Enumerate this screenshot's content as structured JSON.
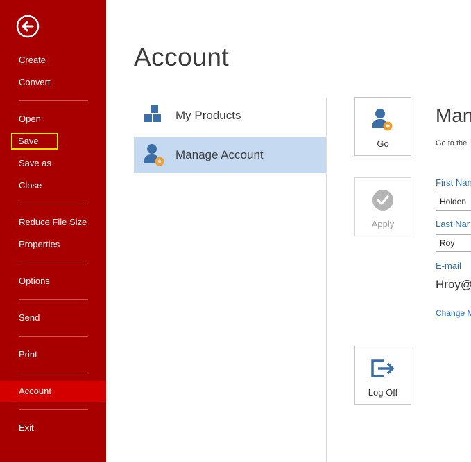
{
  "sidebar": {
    "back_icon": "back-arrow-icon",
    "items": [
      {
        "id": "create",
        "label": "Create"
      },
      {
        "id": "convert",
        "label": "Convert"
      },
      {
        "id": "open",
        "label": "Open"
      },
      {
        "id": "save",
        "label": "Save"
      },
      {
        "id": "save-as",
        "label": "Save as"
      },
      {
        "id": "close",
        "label": "Close"
      },
      {
        "id": "reduce-file-size",
        "label": "Reduce File Size"
      },
      {
        "id": "properties",
        "label": "Properties"
      },
      {
        "id": "options",
        "label": "Options"
      },
      {
        "id": "send",
        "label": "Send"
      },
      {
        "id": "print",
        "label": "Print"
      },
      {
        "id": "account",
        "label": "Account"
      },
      {
        "id": "exit",
        "label": "Exit"
      }
    ]
  },
  "main": {
    "title": "Account",
    "nav": [
      {
        "label": "My Products",
        "icon": "blocks-icon"
      },
      {
        "label": "Manage Account",
        "icon": "user-gear-icon"
      }
    ],
    "tiles": {
      "go": {
        "label": "Go",
        "icon": "user-gear-icon"
      },
      "apply": {
        "label": "Apply",
        "icon": "check-circle-icon"
      },
      "logoff": {
        "label": "Log Off",
        "icon": "logoff-icon"
      }
    },
    "detail": {
      "title": "Man",
      "subtitle": "Go to the",
      "first_name_label": "First Nan",
      "first_name_value": "Holden",
      "last_name_label": "Last Nar",
      "last_name_value": "Roy",
      "email_label": "E-mail",
      "email_value": "Hroy@",
      "change_link": "Change M"
    }
  },
  "colors": {
    "sidebar_bg": "#a80000",
    "sidebar_active": "#d40000",
    "highlight_outline": "#f5e600",
    "selection_bg": "#c5d9f1",
    "link_blue": "#2a6ebb",
    "icon_blue": "#3c6fa8",
    "icon_orange": "#f0a030"
  }
}
